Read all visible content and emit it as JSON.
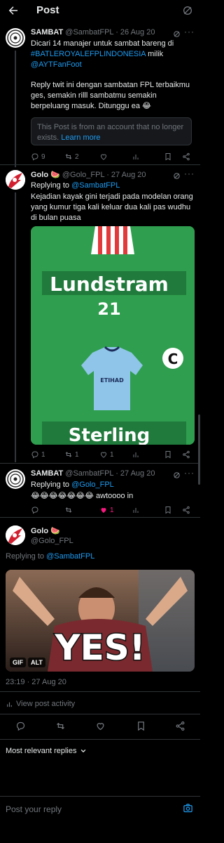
{
  "header": {
    "title": "Post"
  },
  "tweet1": {
    "name": "SAMBAT",
    "handle_date": "@SambatFPL · 26 Aug 20",
    "text_1": "Dicari 14 manajer untuk sambat bareng di",
    "hashtag": "#BATLEROYALEFPLINDONESIA",
    "text_2": " milik",
    "mention": "@AYTFanFoot",
    "text_3": "Reply twit ini dengan sambatan FPL terbaikmu ges, semakin rilll sambatmu semakin berpeluang masuk. Ditunggu ea 😂",
    "notice_text": "This Post is from an account that no longer exists.",
    "notice_link": "Learn more",
    "replies": "9",
    "reposts": "2"
  },
  "tweet2": {
    "name": "Golo 🍉",
    "handle_date": "@Golo_FPL · 27 Aug 20",
    "replying_prefix": "Replying to ",
    "replying_to": "@SambatFPL",
    "text": "Kejadian kayak gini terjadi pada modelan orang yang kumur tiga kali keluar dua kali pas wudhu di bulan puasa",
    "player_1": "Lundstram",
    "player_1_points": "21",
    "player_2": "Sterling",
    "captain_mark": "C",
    "shirt_sponsor": "ETIHAD",
    "replies": "1",
    "reposts": "1",
    "likes": "1"
  },
  "tweet3": {
    "name": "SAMBAT",
    "handle_date": "@SambatFPL · 27 Aug 20",
    "replying_prefix": "Replying to ",
    "replying_to": "@Golo_FPL",
    "text": "😂😂😂😂😂😂😂 awtoooo in",
    "likes": "1"
  },
  "main": {
    "name": "Golo 🍉",
    "handle": "@Golo_FPL",
    "replying_prefix": "Replying to ",
    "replying_to": "@SambatFPL",
    "gif_text": "YES!",
    "gif_badge": "GIF",
    "alt_badge": "ALT",
    "timestamp": "23:19 · 27 Aug 20",
    "view_activity": "View post activity"
  },
  "replies_filter": {
    "label": "Most relevant replies"
  },
  "reply_box": {
    "placeholder": "Post your reply"
  },
  "colors": {
    "accent": "#1d9bf0",
    "like": "#f91880",
    "background": "#000000",
    "muted": "#71767b"
  },
  "icons": [
    "back-arrow-icon",
    "grok-icon",
    "more-icon",
    "reply-icon",
    "repost-icon",
    "like-icon",
    "views-icon",
    "bookmark-icon",
    "share-icon",
    "activity-icon",
    "chevron-down-icon",
    "camera-icon"
  ]
}
